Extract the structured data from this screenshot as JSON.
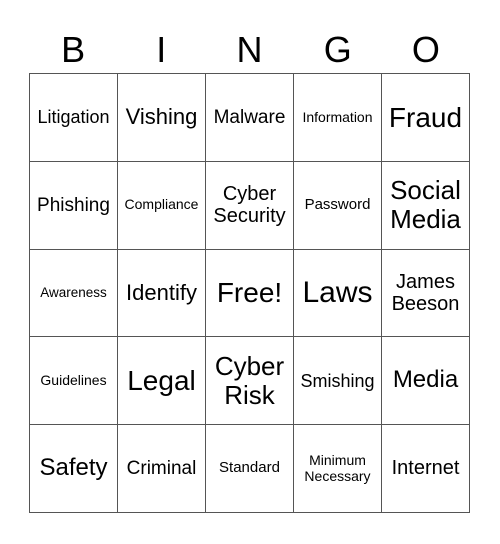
{
  "header": [
    "B",
    "I",
    "N",
    "G",
    "O"
  ],
  "cells": [
    "Litigation",
    "Vishing",
    "Malware",
    "Information",
    "Fraud",
    "Phishing",
    "Compliance",
    "Cyber Security",
    "Password",
    "Social Media",
    "Awareness",
    "Identify",
    "Free!",
    "Laws",
    "James Beeson",
    "Guidelines",
    "Legal",
    "Cyber Risk",
    "Smishing",
    "Media",
    "Safety",
    "Criminal",
    "Standard",
    "Minimum Necessary",
    "Internet"
  ]
}
